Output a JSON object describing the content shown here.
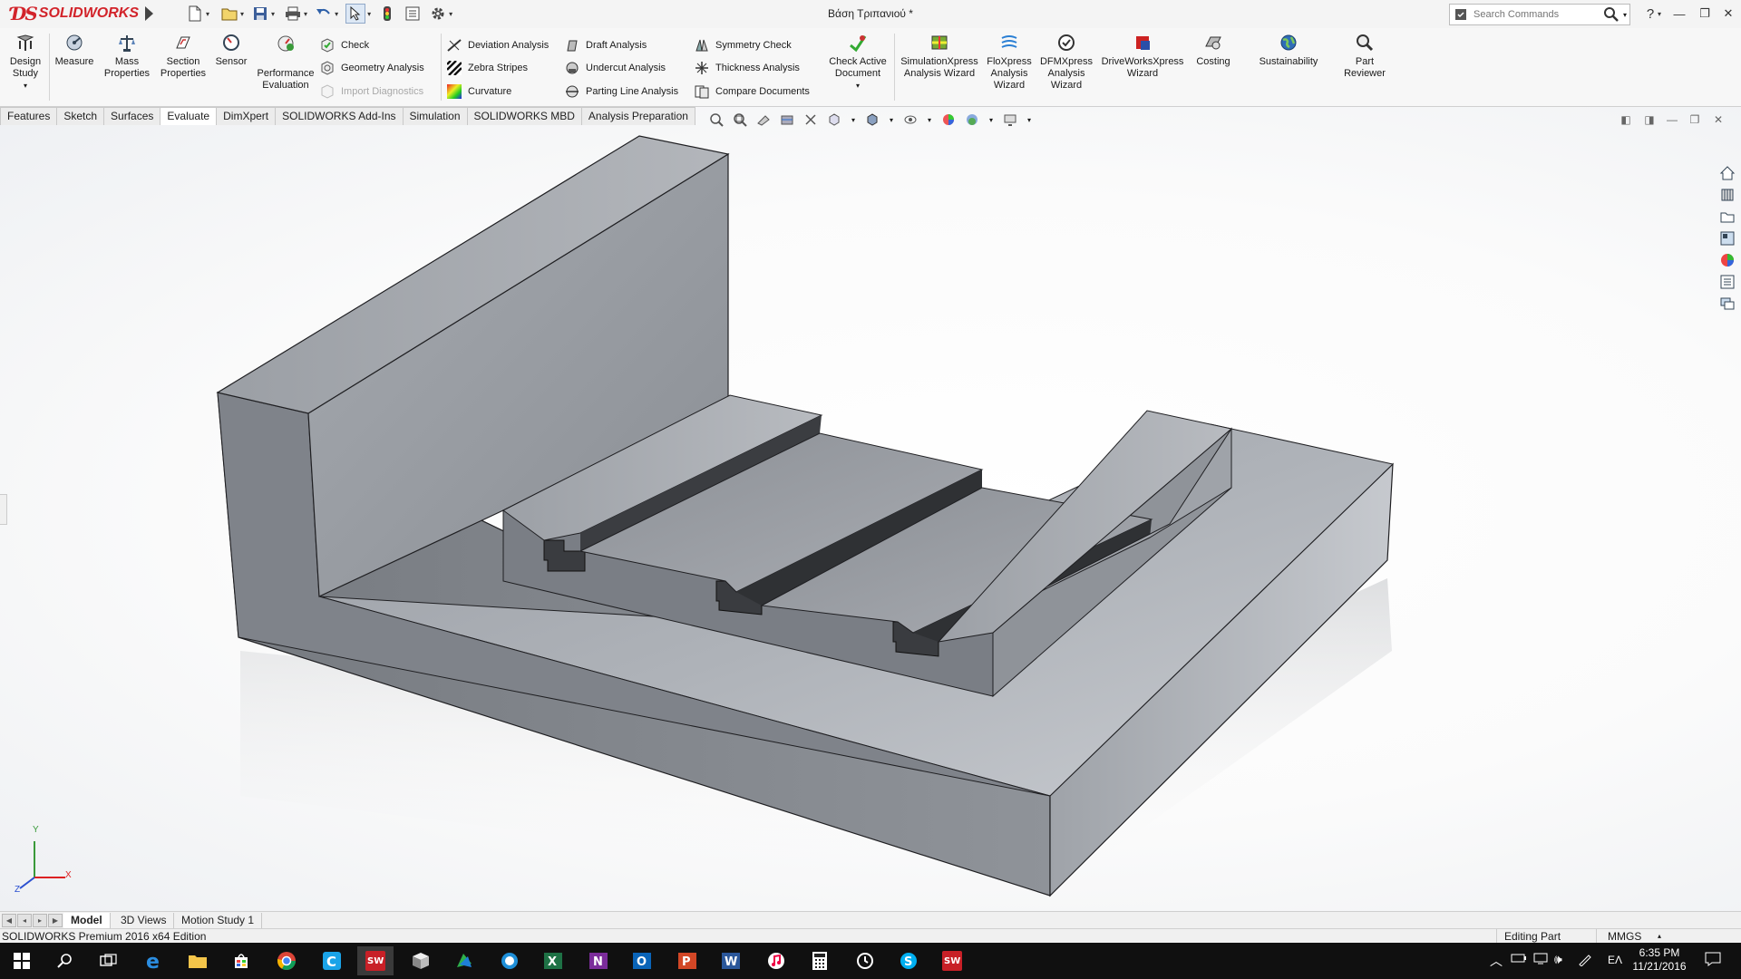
{
  "app": {
    "brand": "SOLIDWORKS",
    "document_title": "Βάση Τριπανιού *",
    "search_placeholder": "Search Commands",
    "help_label": "?"
  },
  "ribbon": {
    "big_buttons": [
      {
        "id": "design-study",
        "label": "Design\nStudy",
        "icon": "design-study-icon"
      },
      {
        "id": "measure",
        "label": "Measure",
        "icon": "measure-icon"
      },
      {
        "id": "mass-properties",
        "label": "Mass\nProperties",
        "icon": "scale-icon"
      },
      {
        "id": "section-properties",
        "label": "Section\nProperties",
        "icon": "section-icon"
      },
      {
        "id": "sensor",
        "label": "Sensor",
        "icon": "sensor-icon"
      },
      {
        "id": "performance-evaluation",
        "label": "Performance\nEvaluation",
        "icon": "performance-icon"
      },
      {
        "id": "check-active-document",
        "label": "Check Active\nDocument",
        "icon": "check-doc-icon"
      },
      {
        "id": "simulationxpress",
        "label": "SimulationXpress\nAnalysis Wizard",
        "icon": "simulation-icon"
      },
      {
        "id": "floxpress",
        "label": "FloXpress\nAnalysis\nWizard",
        "icon": "flow-icon"
      },
      {
        "id": "dfmxpress",
        "label": "DFMXpress\nAnalysis\nWizard",
        "icon": "dfm-icon"
      },
      {
        "id": "driveworksxpress",
        "label": "DriveWorksXpress\nWizard",
        "icon": "driveworks-icon"
      },
      {
        "id": "costing",
        "label": "Costing",
        "icon": "costing-icon"
      },
      {
        "id": "sustainability",
        "label": "Sustainability",
        "icon": "globe-icon"
      },
      {
        "id": "part-reviewer",
        "label": "Part\nReviewer",
        "icon": "reviewer-icon"
      }
    ],
    "small_buttons": {
      "check": "Check",
      "geometry_analysis": "Geometry Analysis",
      "import_diagnostics": "Import Diagnostics",
      "deviation_analysis": "Deviation Analysis",
      "zebra_stripes": "Zebra Stripes",
      "curvature": "Curvature",
      "draft_analysis": "Draft Analysis",
      "undercut_analysis": "Undercut Analysis",
      "parting_line_analysis": "Parting Line Analysis",
      "symmetry_check": "Symmetry Check",
      "thickness_analysis": "Thickness Analysis",
      "compare_documents": "Compare Documents"
    }
  },
  "tabs": [
    "Features",
    "Sketch",
    "Surfaces",
    "Evaluate",
    "DimXpert",
    "SOLIDWORKS Add-Ins",
    "Simulation",
    "SOLIDWORKS MBD",
    "Analysis Preparation"
  ],
  "active_tab": "Evaluate",
  "triad": {
    "x": "X",
    "y": "Y",
    "z": "Z"
  },
  "bottom_tabs": [
    "Model",
    "3D Views",
    "Motion Study 1"
  ],
  "status": {
    "edition": "SOLIDWORKS Premium 2016 x64 Edition",
    "mode": "Editing Part",
    "units": "MMGS"
  },
  "taskbar": {
    "language": "ΕΛ",
    "time": "6:35 PM",
    "date": "11/21/2016",
    "sw_badge": "SW"
  },
  "colors": {
    "brand_red": "#d2232a",
    "part_gray": "#8a8e95",
    "taskbar": "#101010"
  }
}
